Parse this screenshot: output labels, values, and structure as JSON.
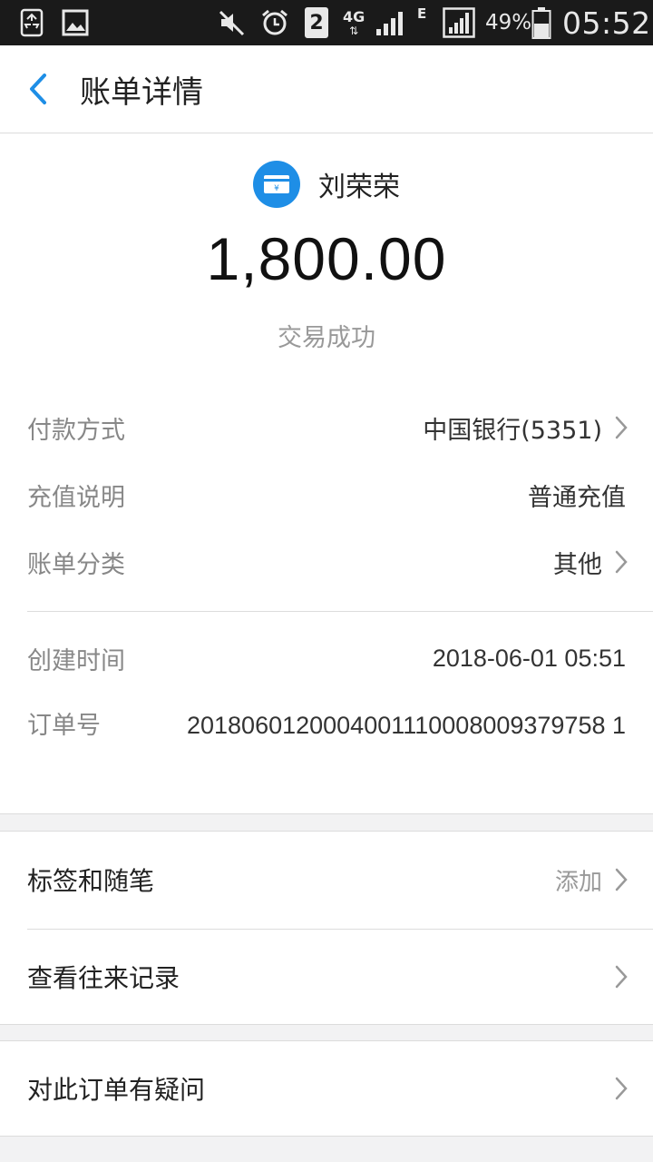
{
  "status_bar": {
    "network": "4G",
    "signal_type": "E",
    "sim_slot": "2",
    "battery": "49%",
    "time": "05:52"
  },
  "header": {
    "title": "账单详情"
  },
  "bill": {
    "payee_name": "刘荣荣",
    "amount": "1,800.00",
    "status": "交易成功",
    "rows": [
      {
        "label": "付款方式",
        "value": "中国银行(5351)"
      },
      {
        "label": "充值说明",
        "value": "普通充值"
      },
      {
        "label": "账单分类",
        "value": "其他"
      },
      {
        "label": "创建时间",
        "value": "2018-06-01 05:51"
      },
      {
        "label": "订单号",
        "value": "2018060120004001110008009379758 1"
      }
    ]
  },
  "menu": {
    "tags_label": "标签和随笔",
    "tags_action": "添加",
    "history_label": "查看往来记录",
    "question_label": "对此订单有疑问"
  },
  "colors": {
    "accent": "#1e8ee6",
    "status_bar_bg": "#1a1a1a",
    "page_bg": "#f2f2f3"
  }
}
